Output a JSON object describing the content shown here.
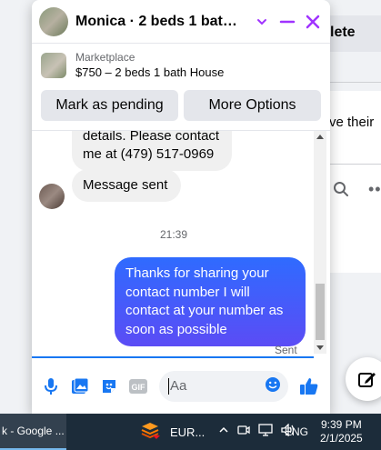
{
  "background": {
    "button_label": "lete",
    "snippet": "ve their",
    "more": "•••"
  },
  "chat": {
    "title": "Monica · 2 beds 1 bath Ho...",
    "marketplace": {
      "label": "Marketplace",
      "listing": "$750 – 2 beds 1 bath House",
      "mark_pending": "Mark as pending",
      "more_options": "More Options"
    },
    "messages": {
      "incoming_partial": "details. Please contact me at (479) 517-0969",
      "incoming_sent": "Message sent",
      "timestamp": "21:39",
      "outgoing": "Thanks for sharing your contact number I will contact at your number as soon as possible",
      "status": "Sent"
    },
    "composer": {
      "placeholder": "Aa"
    }
  },
  "taskbar": {
    "app_label": "k - Google ...",
    "currency": "EUR...",
    "language": "ENG",
    "time": "9:39 PM",
    "date": "2/1/2025"
  },
  "colors": {
    "accent": "#1877f2",
    "brand_purple": "#a033ff",
    "taskbar": "#1c2c3a"
  }
}
